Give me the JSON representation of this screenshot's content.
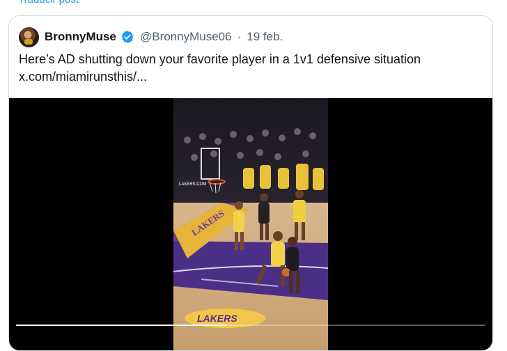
{
  "top_link": "Traducir post",
  "tweet": {
    "author_name": "BronnyMuse",
    "author_handle": "@BronnyMuse06",
    "separator": "·",
    "date": "19 feb.",
    "text_line1": "Here’s AD shutting down your favorite player in a 1v1 defensive situation",
    "text_line2": "x.com/miamirunsthis/..."
  },
  "video": {
    "progress_fraction": 0.45,
    "court_text": "LAKERS",
    "board_text": "LAKERS.COM"
  },
  "icons": [
    "avatar",
    "verified-badge-icon"
  ],
  "colors": {
    "link": "#1d9bf0",
    "verified": "#1d9bf0",
    "handle": "#536471",
    "lakers_purple": "#552583",
    "lakers_gold": "#fdb927"
  }
}
